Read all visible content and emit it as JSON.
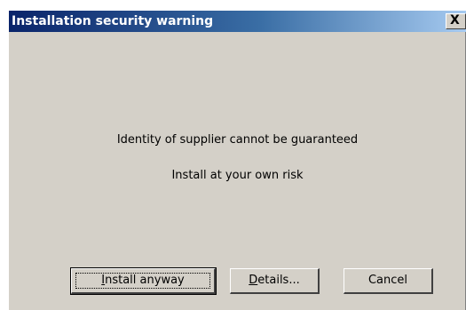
{
  "window": {
    "title": "Installation security warning",
    "close_glyph": "X"
  },
  "message": {
    "line1": "Identity of supplier cannot be guaranteed",
    "line2": "Install at your own risk"
  },
  "buttons": {
    "install": {
      "accel": "I",
      "rest": "nstall anyway"
    },
    "details": {
      "accel": "D",
      "rest": "etails..."
    },
    "cancel": {
      "label": "Cancel"
    }
  },
  "colors": {
    "titlebar_start": "#0a246a",
    "titlebar_end": "#a6caf0",
    "dialog_face": "#d4d0c8"
  }
}
